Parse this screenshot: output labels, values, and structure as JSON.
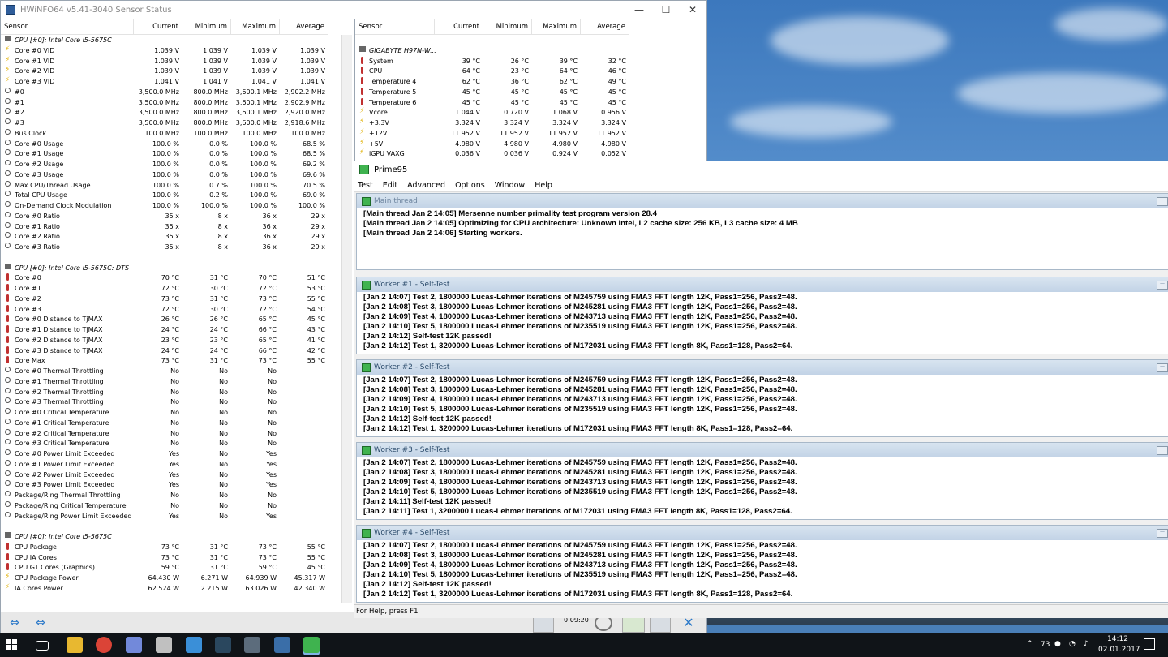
{
  "hwinfo": {
    "title": "HWiNFO64 v5.41-3040 Sensor Status",
    "columns": [
      "Sensor",
      "Current",
      "Minimum",
      "Maximum",
      "Average"
    ],
    "left_rows": [
      {
        "t": "grp",
        "n": "CPU [#0]: Intel Core i5-5675C"
      },
      {
        "t": "vid",
        "n": "Core #0 VID",
        "c": "1.039 V",
        "mi": "1.039 V",
        "ma": "1.039 V",
        "av": "1.039 V"
      },
      {
        "t": "vid",
        "n": "Core #1 VID",
        "c": "1.039 V",
        "mi": "1.039 V",
        "ma": "1.039 V",
        "av": "1.039 V"
      },
      {
        "t": "vid",
        "n": "Core #2 VID",
        "c": "1.039 V",
        "mi": "1.039 V",
        "ma": "1.039 V",
        "av": "1.039 V"
      },
      {
        "t": "vid",
        "n": "Core #3 VID",
        "c": "1.041 V",
        "mi": "1.041 V",
        "ma": "1.041 V",
        "av": "1.041 V"
      },
      {
        "t": "clk",
        "n": "#0",
        "c": "3,500.0 MHz",
        "mi": "800.0 MHz",
        "ma": "3,600.1 MHz",
        "av": "2,902.2 MHz"
      },
      {
        "t": "clk",
        "n": "#1",
        "c": "3,500.0 MHz",
        "mi": "800.0 MHz",
        "ma": "3,600.1 MHz",
        "av": "2,902.9 MHz"
      },
      {
        "t": "clk",
        "n": "#2",
        "c": "3,500.0 MHz",
        "mi": "800.0 MHz",
        "ma": "3,600.1 MHz",
        "av": "2,920.0 MHz"
      },
      {
        "t": "clk",
        "n": "#3",
        "c": "3,500.0 MHz",
        "mi": "800.0 MHz",
        "ma": "3,600.0 MHz",
        "av": "2,918.6 MHz"
      },
      {
        "t": "clk",
        "n": "Bus Clock",
        "c": "100.0 MHz",
        "mi": "100.0 MHz",
        "ma": "100.0 MHz",
        "av": "100.0 MHz"
      },
      {
        "t": "clk",
        "n": "Core #0 Usage",
        "c": "100.0 %",
        "mi": "0.0 %",
        "ma": "100.0 %",
        "av": "68.5 %"
      },
      {
        "t": "clk",
        "n": "Core #1 Usage",
        "c": "100.0 %",
        "mi": "0.0 %",
        "ma": "100.0 %",
        "av": "68.5 %"
      },
      {
        "t": "clk",
        "n": "Core #2 Usage",
        "c": "100.0 %",
        "mi": "0.0 %",
        "ma": "100.0 %",
        "av": "69.2 %"
      },
      {
        "t": "clk",
        "n": "Core #3 Usage",
        "c": "100.0 %",
        "mi": "0.0 %",
        "ma": "100.0 %",
        "av": "69.6 %"
      },
      {
        "t": "clk",
        "n": "Max CPU/Thread Usage",
        "c": "100.0 %",
        "mi": "0.7 %",
        "ma": "100.0 %",
        "av": "70.5 %"
      },
      {
        "t": "clk",
        "n": "Total CPU Usage",
        "c": "100.0 %",
        "mi": "0.2 %",
        "ma": "100.0 %",
        "av": "69.0 %"
      },
      {
        "t": "clk",
        "n": "On-Demand Clock Modulation",
        "c": "100.0 %",
        "mi": "100.0 %",
        "ma": "100.0 %",
        "av": "100.0 %"
      },
      {
        "t": "clk",
        "n": "Core #0 Ratio",
        "c": "35 x",
        "mi": "8 x",
        "ma": "36 x",
        "av": "29 x"
      },
      {
        "t": "clk",
        "n": "Core #1 Ratio",
        "c": "35 x",
        "mi": "8 x",
        "ma": "36 x",
        "av": "29 x"
      },
      {
        "t": "clk",
        "n": "Core #2 Ratio",
        "c": "35 x",
        "mi": "8 x",
        "ma": "36 x",
        "av": "29 x"
      },
      {
        "t": "clk",
        "n": "Core #3 Ratio",
        "c": "35 x",
        "mi": "8 x",
        "ma": "36 x",
        "av": "29 x"
      },
      {
        "t": "blank",
        "n": ""
      },
      {
        "t": "grp",
        "n": "CPU [#0]: Intel Core i5-5675C: DTS"
      },
      {
        "t": "tmp",
        "n": "Core #0",
        "c": "70 °C",
        "mi": "31 °C",
        "ma": "70 °C",
        "av": "51 °C"
      },
      {
        "t": "tmp",
        "n": "Core #1",
        "c": "72 °C",
        "mi": "30 °C",
        "ma": "72 °C",
        "av": "53 °C"
      },
      {
        "t": "tmp",
        "n": "Core #2",
        "c": "73 °C",
        "mi": "31 °C",
        "ma": "73 °C",
        "av": "55 °C"
      },
      {
        "t": "tmp",
        "n": "Core #3",
        "c": "72 °C",
        "mi": "30 °C",
        "ma": "72 °C",
        "av": "54 °C"
      },
      {
        "t": "tmp",
        "n": "Core #0 Distance to TjMAX",
        "c": "26 °C",
        "mi": "26 °C",
        "ma": "65 °C",
        "av": "45 °C"
      },
      {
        "t": "tmp",
        "n": "Core #1 Distance to TjMAX",
        "c": "24 °C",
        "mi": "24 °C",
        "ma": "66 °C",
        "av": "43 °C"
      },
      {
        "t": "tmp",
        "n": "Core #2 Distance to TjMAX",
        "c": "23 °C",
        "mi": "23 °C",
        "ma": "65 °C",
        "av": "41 °C"
      },
      {
        "t": "tmp",
        "n": "Core #3 Distance to TjMAX",
        "c": "24 °C",
        "mi": "24 °C",
        "ma": "66 °C",
        "av": "42 °C"
      },
      {
        "t": "tmp",
        "n": "Core Max",
        "c": "73 °C",
        "mi": "31 °C",
        "ma": "73 °C",
        "av": "55 °C"
      },
      {
        "t": "clk",
        "n": "Core #0 Thermal Throttling",
        "c": "No",
        "mi": "No",
        "ma": "No",
        "av": ""
      },
      {
        "t": "clk",
        "n": "Core #1 Thermal Throttling",
        "c": "No",
        "mi": "No",
        "ma": "No",
        "av": ""
      },
      {
        "t": "clk",
        "n": "Core #2 Thermal Throttling",
        "c": "No",
        "mi": "No",
        "ma": "No",
        "av": ""
      },
      {
        "t": "clk",
        "n": "Core #3 Thermal Throttling",
        "c": "No",
        "mi": "No",
        "ma": "No",
        "av": ""
      },
      {
        "t": "clk",
        "n": "Core #0 Critical Temperature",
        "c": "No",
        "mi": "No",
        "ma": "No",
        "av": ""
      },
      {
        "t": "clk",
        "n": "Core #1 Critical Temperature",
        "c": "No",
        "mi": "No",
        "ma": "No",
        "av": ""
      },
      {
        "t": "clk",
        "n": "Core #2 Critical Temperature",
        "c": "No",
        "mi": "No",
        "ma": "No",
        "av": ""
      },
      {
        "t": "clk",
        "n": "Core #3 Critical Temperature",
        "c": "No",
        "mi": "No",
        "ma": "No",
        "av": ""
      },
      {
        "t": "clk",
        "n": "Core #0 Power Limit Exceeded",
        "c": "Yes",
        "mi": "No",
        "ma": "Yes",
        "av": ""
      },
      {
        "t": "clk",
        "n": "Core #1 Power Limit Exceeded",
        "c": "Yes",
        "mi": "No",
        "ma": "Yes",
        "av": ""
      },
      {
        "t": "clk",
        "n": "Core #2 Power Limit Exceeded",
        "c": "Yes",
        "mi": "No",
        "ma": "Yes",
        "av": ""
      },
      {
        "t": "clk",
        "n": "Core #3 Power Limit Exceeded",
        "c": "Yes",
        "mi": "No",
        "ma": "Yes",
        "av": ""
      },
      {
        "t": "clk",
        "n": "Package/Ring Thermal Throttling",
        "c": "No",
        "mi": "No",
        "ma": "No",
        "av": ""
      },
      {
        "t": "clk",
        "n": "Package/Ring Critical Temperature",
        "c": "No",
        "mi": "No",
        "ma": "No",
        "av": ""
      },
      {
        "t": "clk",
        "n": "Package/Ring Power Limit Exceeded",
        "c": "Yes",
        "mi": "No",
        "ma": "Yes",
        "av": ""
      },
      {
        "t": "blank",
        "n": ""
      },
      {
        "t": "grp",
        "n": "CPU [#0]: Intel Core i5-5675C"
      },
      {
        "t": "tmp",
        "n": "CPU Package",
        "c": "73 °C",
        "mi": "31 °C",
        "ma": "73 °C",
        "av": "55 °C"
      },
      {
        "t": "tmp",
        "n": "CPU IA Cores",
        "c": "73 °C",
        "mi": "31 °C",
        "ma": "73 °C",
        "av": "55 °C"
      },
      {
        "t": "tmp",
        "n": "CPU GT Cores (Graphics)",
        "c": "59 °C",
        "mi": "31 °C",
        "ma": "59 °C",
        "av": "45 °C"
      },
      {
        "t": "pwr",
        "n": "CPU Package Power",
        "c": "64.430 W",
        "mi": "6.271 W",
        "ma": "64.939 W",
        "av": "45.317 W"
      },
      {
        "t": "pwr",
        "n": "IA Cores Power",
        "c": "62.524 W",
        "mi": "2.215 W",
        "ma": "63.026 W",
        "av": "42.340 W"
      }
    ],
    "right_rows": [
      {
        "t": "blank",
        "n": ""
      },
      {
        "t": "grp",
        "n": "GIGABYTE H97N-W..."
      },
      {
        "t": "tmp",
        "n": "System",
        "c": "39 °C",
        "mi": "26 °C",
        "ma": "39 °C",
        "av": "32 °C"
      },
      {
        "t": "tmp",
        "n": "CPU",
        "c": "64 °C",
        "mi": "23 °C",
        "ma": "64 °C",
        "av": "46 °C"
      },
      {
        "t": "tmp",
        "n": "Temperature 4",
        "c": "62 °C",
        "mi": "36 °C",
        "ma": "62 °C",
        "av": "49 °C"
      },
      {
        "t": "tmp",
        "n": "Temperature 5",
        "c": "45 °C",
        "mi": "45 °C",
        "ma": "45 °C",
        "av": "45 °C"
      },
      {
        "t": "tmp",
        "n": "Temperature 6",
        "c": "45 °C",
        "mi": "45 °C",
        "ma": "45 °C",
        "av": "45 °C"
      },
      {
        "t": "vid",
        "n": "Vcore",
        "c": "1.044 V",
        "mi": "0.720 V",
        "ma": "1.068 V",
        "av": "0.956 V"
      },
      {
        "t": "vid",
        "n": "+3.3V",
        "c": "3.324 V",
        "mi": "3.324 V",
        "ma": "3.324 V",
        "av": "3.324 V"
      },
      {
        "t": "vid",
        "n": "+12V",
        "c": "11.952 V",
        "mi": "11.952 V",
        "ma": "11.952 V",
        "av": "11.952 V"
      },
      {
        "t": "vid",
        "n": "+5V",
        "c": "4.980 V",
        "mi": "4.980 V",
        "ma": "4.980 V",
        "av": "4.980 V"
      },
      {
        "t": "vid",
        "n": "iGPU VAXG",
        "c": "0.036 V",
        "mi": "0.036 V",
        "ma": "0.924 V",
        "av": "0.052 V"
      }
    ],
    "timer": "0:09:20"
  },
  "prime95": {
    "title": "Prime95",
    "menu": [
      "Test",
      "Edit",
      "Advanced",
      "Options",
      "Window",
      "Help"
    ],
    "status": "For Help, press F1",
    "panes": [
      {
        "title": "Main thread",
        "lines": [
          "[Main thread Jan 2 14:05] Mersenne number primality test program version 28.4",
          "[Main thread Jan 2 14:05] Optimizing for CPU architecture: Unknown Intel, L2 cache size: 256 KB, L3 cache size: 4 MB",
          "[Main thread Jan 2 14:06] Starting workers."
        ]
      },
      {
        "title": "Worker #1 - Self-Test",
        "lines": [
          "[Jan 2 14:07] Test 2, 1800000 Lucas-Lehmer iterations of M245759 using FMA3 FFT length 12K, Pass1=256, Pass2=48.",
          "[Jan 2 14:08] Test 3, 1800000 Lucas-Lehmer iterations of M245281 using FMA3 FFT length 12K, Pass1=256, Pass2=48.",
          "[Jan 2 14:09] Test 4, 1800000 Lucas-Lehmer iterations of M243713 using FMA3 FFT length 12K, Pass1=256, Pass2=48.",
          "[Jan 2 14:10] Test 5, 1800000 Lucas-Lehmer iterations of M235519 using FMA3 FFT length 12K, Pass1=256, Pass2=48.",
          "[Jan 2 14:12] Self-test 12K passed!",
          "[Jan 2 14:12] Test 1, 3200000 Lucas-Lehmer iterations of M172031 using FMA3 FFT length 8K, Pass1=128, Pass2=64."
        ]
      },
      {
        "title": "Worker #2 - Self-Test",
        "lines": [
          "[Jan 2 14:07] Test 2, 1800000 Lucas-Lehmer iterations of M245759 using FMA3 FFT length 12K, Pass1=256, Pass2=48.",
          "[Jan 2 14:08] Test 3, 1800000 Lucas-Lehmer iterations of M245281 using FMA3 FFT length 12K, Pass1=256, Pass2=48.",
          "[Jan 2 14:09] Test 4, 1800000 Lucas-Lehmer iterations of M243713 using FMA3 FFT length 12K, Pass1=256, Pass2=48.",
          "[Jan 2 14:10] Test 5, 1800000 Lucas-Lehmer iterations of M235519 using FMA3 FFT length 12K, Pass1=256, Pass2=48.",
          "[Jan 2 14:12] Self-test 12K passed!",
          "[Jan 2 14:12] Test 1, 3200000 Lucas-Lehmer iterations of M172031 using FMA3 FFT length 8K, Pass1=128, Pass2=64."
        ]
      },
      {
        "title": "Worker #3 - Self-Test",
        "lines": [
          "[Jan 2 14:07] Test 2, 1800000 Lucas-Lehmer iterations of M245759 using FMA3 FFT length 12K, Pass1=256, Pass2=48.",
          "[Jan 2 14:08] Test 3, 1800000 Lucas-Lehmer iterations of M245281 using FMA3 FFT length 12K, Pass1=256, Pass2=48.",
          "[Jan 2 14:09] Test 4, 1800000 Lucas-Lehmer iterations of M243713 using FMA3 FFT length 12K, Pass1=256, Pass2=48.",
          "[Jan 2 14:10] Test 5, 1800000 Lucas-Lehmer iterations of M235519 using FMA3 FFT length 12K, Pass1=256, Pass2=48.",
          "[Jan 2 14:11] Self-test 12K passed!",
          "[Jan 2 14:11] Test 1, 3200000 Lucas-Lehmer iterations of M172031 using FMA3 FFT length 8K, Pass1=128, Pass2=64."
        ]
      },
      {
        "title": "Worker #4 - Self-Test",
        "lines": [
          "[Jan 2 14:07] Test 2, 1800000 Lucas-Lehmer iterations of M245759 using FMA3 FFT length 12K, Pass1=256, Pass2=48.",
          "[Jan 2 14:08] Test 3, 1800000 Lucas-Lehmer iterations of M245281 using FMA3 FFT length 12K, Pass1=256, Pass2=48.",
          "[Jan 2 14:09] Test 4, 1800000 Lucas-Lehmer iterations of M243713 using FMA3 FFT length 12K, Pass1=256, Pass2=48.",
          "[Jan 2 14:10] Test 5, 1800000 Lucas-Lehmer iterations of M235519 using FMA3 FFT length 12K, Pass1=256, Pass2=48.",
          "[Jan 2 14:12] Self-test 12K passed!",
          "[Jan 2 14:12] Test 1, 3200000 Lucas-Lehmer iterations of M172031 using FMA3 FFT length 8K, Pass1=128, Pass2=64."
        ]
      }
    ]
  },
  "taskbar": {
    "apps": [
      "start-icon",
      "task-view-icon",
      "file-explorer-icon",
      "chrome-icon",
      "discord-icon",
      "steam-link-icon",
      "uplay-icon",
      "steam-icon",
      "xbox-icon",
      "hwinfo-icon",
      "prime95-icon"
    ],
    "tray_number": "73",
    "time": "14:12",
    "date": "02.01.2017"
  }
}
